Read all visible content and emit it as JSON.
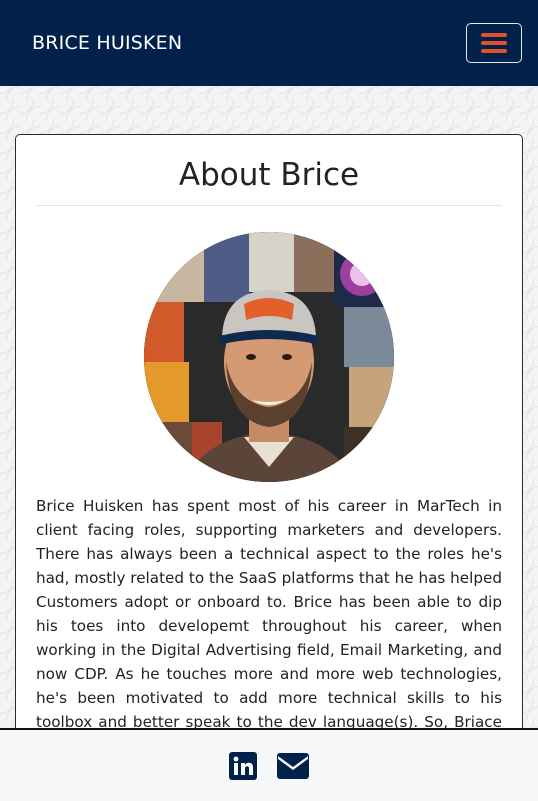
{
  "header": {
    "brand": "BRICE HUISKEN",
    "menu_icon": "hamburger-menu-icon",
    "colors": {
      "navbar_bg": "#02214a",
      "menu_accent": "#e2512d"
    }
  },
  "about": {
    "title": "About Brice",
    "photo_icon": "profile-photo",
    "bio": "Brice Huisken has spent most of his career in MarTech in client facing roles, supporting marketers and developers. There has always been a technical aspect to the roles he's had, mostly related to the SaaS platforms that he has helped Customers adopt or onboard to. Brice has been able to dip his toes into developemt throughout his career, when working in the Digital Advertising field, Email Marketing, and now CDP. As he touches more and more web technologies, he's been motivated to add more technical skills to his toolbox and better speak to the dev language(s). So, Briace has recently enrolled in the University of"
  },
  "footer": {
    "icons": [
      "linkedin-icon",
      "envelope-icon"
    ],
    "colors": {
      "icon": "#02214a"
    }
  }
}
